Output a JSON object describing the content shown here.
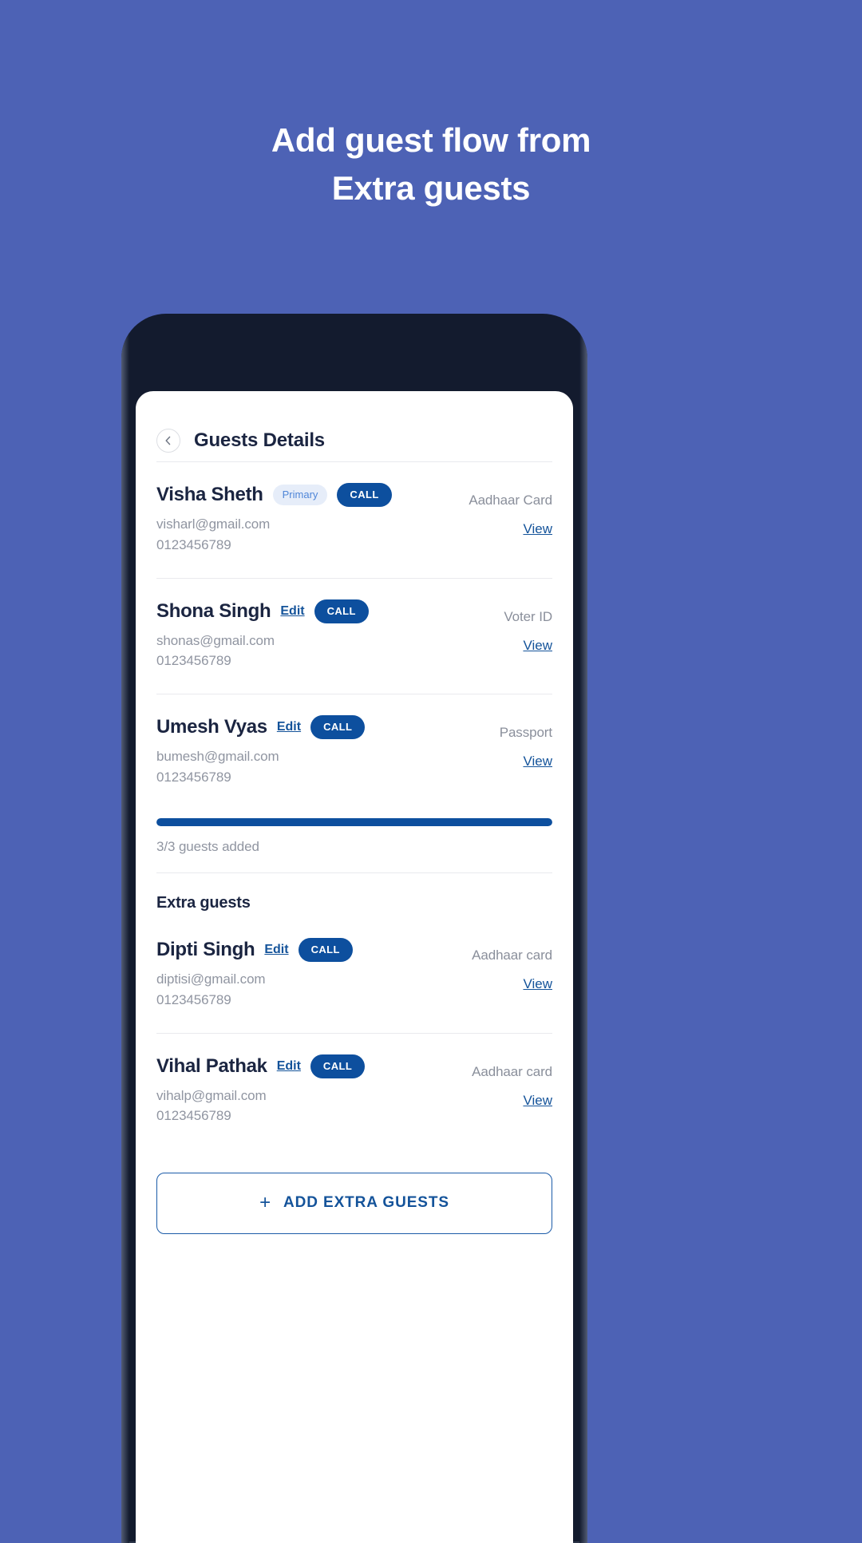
{
  "promo": {
    "line1": "Add guest flow from",
    "line2": "Extra guests",
    "background_color": "#4d62b5",
    "text_color": "#ffffff"
  },
  "colors": {
    "accent": "#0d4f9e",
    "link": "#14539a",
    "chip_bg": "#e6edf9",
    "chip_text": "#4f86d8",
    "muted_text": "#9095a1",
    "title_text": "#1b2541"
  },
  "app": {
    "header": {
      "back_icon": "chevron-left-icon",
      "title": "Guests Details"
    },
    "primary_guests": [
      {
        "name": "Visha Sheth",
        "badge": "Primary",
        "call_label": "CALL",
        "email": "visharl@gmail.com",
        "phone": "0123456789",
        "doc_type": "Aadhaar Card",
        "view_label": "View"
      },
      {
        "name": "Shona Singh",
        "edit_label": "Edit",
        "call_label": "CALL",
        "email": "shonas@gmail.com",
        "phone": "0123456789",
        "doc_type": "Voter ID",
        "view_label": "View"
      },
      {
        "name": "Umesh Vyas",
        "edit_label": "Edit",
        "call_label": "CALL",
        "email": "bumesh@gmail.com",
        "phone": "0123456789",
        "doc_type": "Passport",
        "view_label": "View"
      }
    ],
    "progress": {
      "percent": 100,
      "label": "3/3 guests added"
    },
    "extra_section": {
      "title": "Extra guests",
      "guests": [
        {
          "name": "Dipti Singh",
          "edit_label": "Edit",
          "call_label": "CALL",
          "email": "diptisi@gmail.com",
          "phone": "0123456789",
          "doc_type": "Aadhaar card",
          "view_label": "View"
        },
        {
          "name": "Vihal Pathak",
          "edit_label": "Edit",
          "call_label": "CALL",
          "email": "vihalp@gmail.com",
          "phone": "0123456789",
          "doc_type": "Aadhaar card",
          "view_label": "View"
        }
      ]
    },
    "add_button": {
      "icon": "plus-icon",
      "label": "ADD EXTRA GUESTS"
    }
  }
}
